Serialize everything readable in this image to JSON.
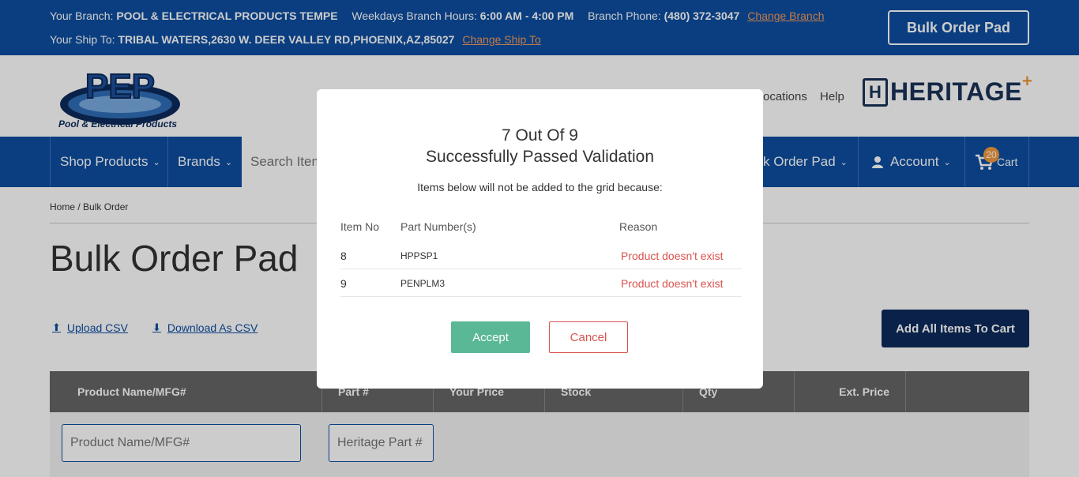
{
  "topbar": {
    "branch_label": "Your Branch:",
    "branch_name": "POOL & ELECTRICAL PRODUCTS TEMPE",
    "hours_label": "Weekdays Branch Hours:",
    "hours_value": "6:00 AM - 4:00 PM",
    "phone_label": "Branch Phone:",
    "phone_value": "(480) 372-3047",
    "change_branch": "Change Branch",
    "ship_label": "Your Ship To:",
    "ship_value": "TRIBAL WATERS,2630 W. DEER VALLEY RD,PHOENIX,AZ,85027",
    "change_ship": "Change Ship To",
    "bulk_order_button": "Bulk Order Pad"
  },
  "header": {
    "logo_tagline": "Pool & Electrical Products",
    "locations_link": "ocations",
    "help_link": "Help",
    "heritage_logo": "HERITAGE"
  },
  "nav": {
    "shop_products": "Shop Products",
    "brands": "Brands",
    "search_placeholder": "Search Item",
    "bulk_order_pad": "k Order Pad",
    "account": "Account",
    "cart": "Cart",
    "cart_count": "20"
  },
  "page": {
    "breadcrumb_home": "Home",
    "breadcrumb_current": "Bulk Order",
    "title": "Bulk Order Pad",
    "upload_csv": "Upload CSV",
    "download_csv": "Download As CSV",
    "add_all": "Add All Items To Cart",
    "grid_headers": [
      "Product Name/MFG#",
      "Part #",
      "Your Price",
      "Stock",
      "Qty",
      "Ext. Price"
    ],
    "product_input_placeholder": "Product Name/MFG#",
    "part_input_placeholder": "Heritage Part #"
  },
  "modal": {
    "title_line1": "7 Out Of 9",
    "title_line2": "Successfully Passed Validation",
    "subtitle": "Items below will not be added to the grid because:",
    "col_item_no": "Item No",
    "col_part_numbers": "Part Number(s)",
    "col_reason": "Reason",
    "rows": [
      {
        "item_no": "8",
        "part_number": "HPPSP1",
        "reason": "Product doesn't exist"
      },
      {
        "item_no": "9",
        "part_number": "PENPLM3",
        "reason": "Product doesn't exist"
      }
    ],
    "accept": "Accept",
    "cancel": "Cancel"
  },
  "colors": {
    "primary_blue": "#0d4ea1",
    "dark_navy": "#0d2b5c",
    "accent_orange": "#f39a3b",
    "accept_green": "#5bb897",
    "error_red": "#d9534f"
  }
}
